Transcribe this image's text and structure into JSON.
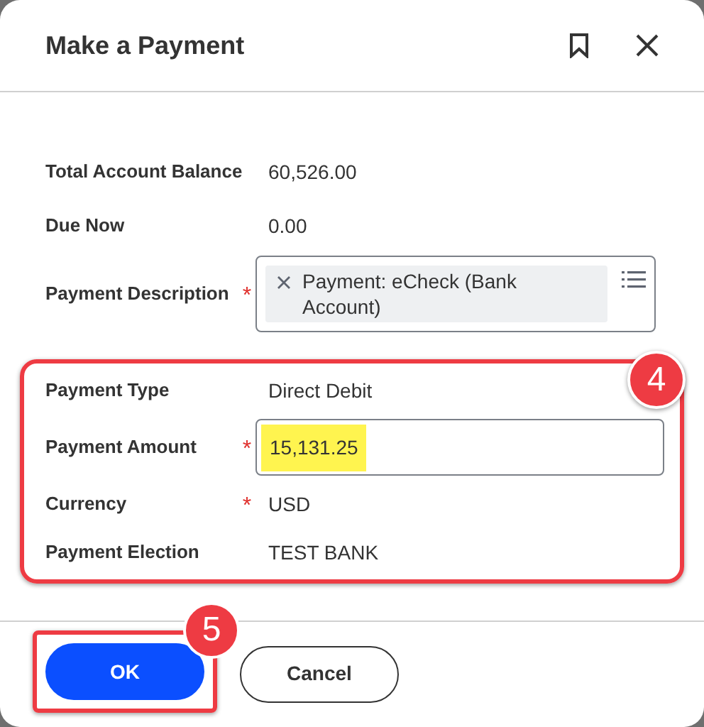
{
  "dialog": {
    "title": "Make a Payment"
  },
  "fields": [
    {
      "label": "Total Account Balance",
      "kind": "text",
      "value": "60,526.00"
    },
    {
      "label": "Due Now",
      "kind": "text",
      "value": "0.00"
    },
    {
      "label": "Payment Description",
      "kind": "chips",
      "required_mark": "*",
      "value": "Payment: eCheck (Bank Account)"
    }
  ],
  "callout": {
    "number": "4",
    "fields": [
      {
        "label": "Payment Type",
        "kind": "text",
        "value": "Direct Debit"
      },
      {
        "label": "Payment Amount",
        "kind": "input",
        "required_mark": "*",
        "value": "15,131.25",
        "highlighted": true
      },
      {
        "label": "Currency",
        "kind": "text",
        "required_mark": "*",
        "value": "USD"
      },
      {
        "label": "Payment Election",
        "kind": "text",
        "value": "TEST BANK"
      }
    ]
  },
  "buttons": [
    {
      "label": "OK",
      "kind": "primary",
      "callout": "5"
    },
    {
      "label": "Cancel",
      "kind": "secondary"
    }
  ]
}
